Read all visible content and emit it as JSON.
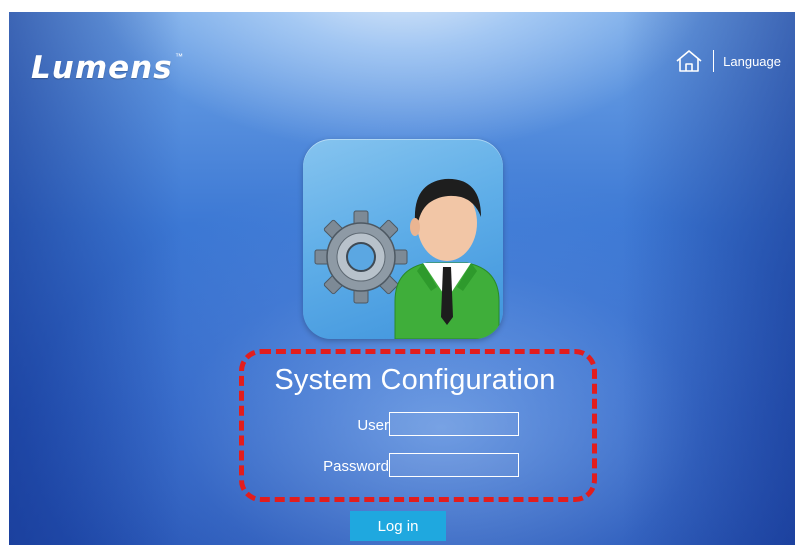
{
  "brand": {
    "logo_text": "Lumens",
    "trademark": "™"
  },
  "topnav": {
    "home_icon": "home-icon",
    "language_label": "Language"
  },
  "app_icon": {
    "icon": "admin-settings-icon"
  },
  "login_form": {
    "title": "System Configuration",
    "user_label": "User",
    "user_value": "",
    "password_label": "Password",
    "password_value": "",
    "login_button": "Log in"
  },
  "colors": {
    "background": "#3c78d4",
    "highlight_dash": "#e21d1d",
    "button": "#1fa8df",
    "text": "#ffffff"
  }
}
